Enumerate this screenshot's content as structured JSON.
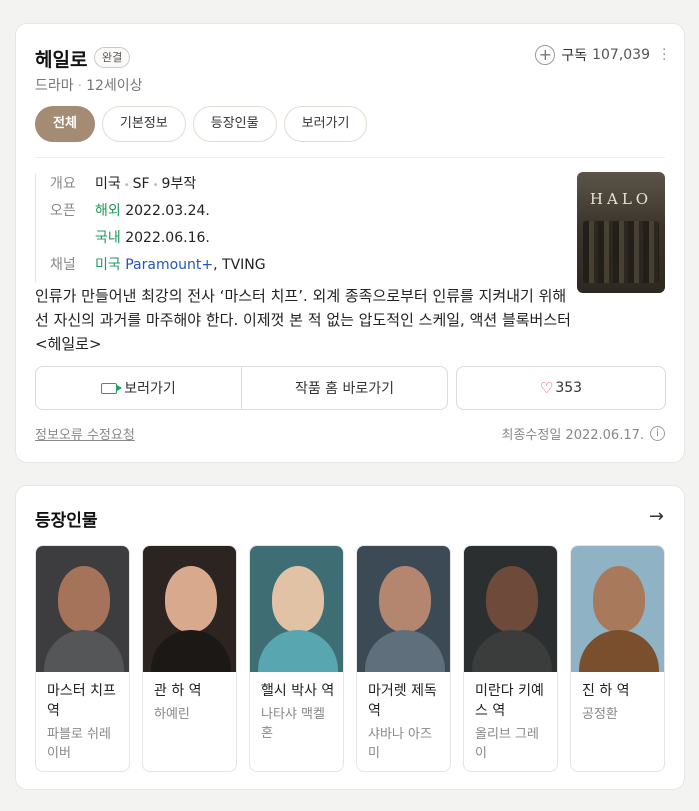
{
  "show": {
    "title": "헤일로",
    "badge": "완결",
    "genre": "드라마",
    "rating": "12세이상",
    "subscribe_label": "구독",
    "subscribe_count": "107,039"
  },
  "tabs": [
    {
      "label": "전체",
      "active": true
    },
    {
      "label": "기본정보",
      "active": false
    },
    {
      "label": "등장인물",
      "active": false
    },
    {
      "label": "보러가기",
      "active": false
    }
  ],
  "info": {
    "overview_label": "개요",
    "country": "미국",
    "genre": "SF",
    "episodes": "9부작",
    "open_label": "오픈",
    "overseas_label": "해외",
    "overseas_date": "2022.03.24.",
    "domestic_label": "국내",
    "domestic_date": "2022.06.16.",
    "channel_label": "채널",
    "channel_country": "미국",
    "channel_main": "Paramount+",
    "channel_extra": ", TVING"
  },
  "description": "인류가 만들어낸 최강의 전사 ‘마스터 치프’. 외계 종족으로부터 인류를 지켜내기 위해선 자신의 과거를 마주해야 한다. 이제껏 본 적 없는 압도적인 스케일, 액션 블록버스터 <헤일로>",
  "poster_logo": "HALO",
  "actions": {
    "watch_label": "보러가기",
    "home_label": "작품 홈 바로가기",
    "like_count": "353"
  },
  "footer": {
    "report_label": "정보오류 수정요청",
    "updated": "최종수정일 2022.06.17."
  },
  "cast_section": {
    "title": "등장인물",
    "members": [
      {
        "role": "마스터 치프 역",
        "actor": "파블로 쉬레이버"
      },
      {
        "role": "관 하 역",
        "actor": "하예린"
      },
      {
        "role": "핼시 박사 역",
        "actor": "나타샤 맥켈혼"
      },
      {
        "role": "마거렛 제독 역",
        "actor": "샤바나 아즈미"
      },
      {
        "role": "미란다 키예스 역",
        "actor": "올리브 그레이"
      },
      {
        "role": "진 하 역",
        "actor": "공정환"
      }
    ]
  },
  "colors": {
    "accent": "#a48b74",
    "green": "#1e9b5c",
    "link_blue": "#2555b8",
    "heart": "#e8435a"
  }
}
